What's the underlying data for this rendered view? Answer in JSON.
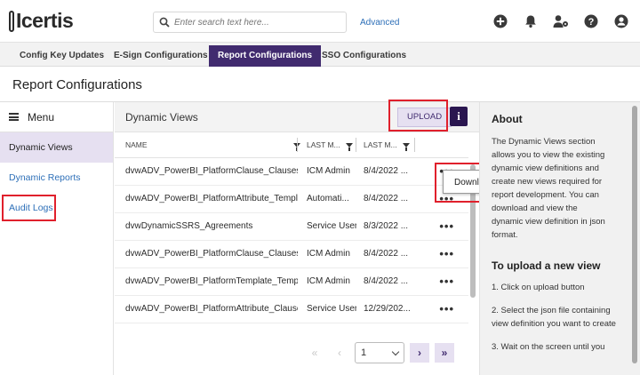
{
  "app": {
    "logo": "Icertis"
  },
  "search": {
    "placeholder": "Enter search text here...",
    "advanced_label": "Advanced"
  },
  "top_icons": [
    "add-icon",
    "bell-icon",
    "user-settings-icon",
    "help-icon",
    "account-icon"
  ],
  "tabs": [
    {
      "label": "Config Key Updates"
    },
    {
      "label": "E-Sign Configurations"
    },
    {
      "label": "Report Configurations",
      "active": true
    },
    {
      "label": "SSO Configurations"
    }
  ],
  "page": {
    "title": "Report Configurations"
  },
  "sidebar": {
    "menu_label": "Menu",
    "items": [
      {
        "label": "Dynamic Views",
        "active": true
      },
      {
        "label": "Dynamic Reports"
      },
      {
        "label": "Audit Logs"
      }
    ]
  },
  "panel": {
    "title": "Dynamic Views",
    "upload_label": "UPLOAD",
    "info_label": "i",
    "columns": [
      "NAME",
      "LAST M...",
      "LAST M..."
    ],
    "rows": [
      {
        "name": "dvwADV_PowerBI_PlatformClause_Clauses",
        "modified_by": "ICM Admin",
        "modified_on": "8/4/2022 ..."
      },
      {
        "name": "dvwADV_PowerBI_PlatformAttribute_Templa...",
        "modified_by": "Automati...",
        "modified_on": "8/4/2022 ..."
      },
      {
        "name": "dvwDynamicSSRS_Agreements",
        "modified_by": "Service User",
        "modified_on": "8/3/2022 ..."
      },
      {
        "name": "dvwADV_PowerBI_PlatformClause_ClausesP...",
        "modified_by": "ICM Admin",
        "modified_on": "8/4/2022 ..."
      },
      {
        "name": "dvwADV_PowerBI_PlatformTemplate_Templ...",
        "modified_by": "ICM Admin",
        "modified_on": "8/4/2022 ..."
      },
      {
        "name": "dvwADV_PowerBI_PlatformAttribute_Clauses",
        "modified_by": "Service User",
        "modified_on": "12/29/202..."
      }
    ],
    "row_action_label": "•••",
    "popup_label": "Download",
    "pagination": {
      "first": "«",
      "prev": "‹",
      "page": "1",
      "next": "›",
      "last": "»"
    }
  },
  "about": {
    "title": "About",
    "text": "The Dynamic Views section allows you to view the existing dynamic view definitions and create new views required for report development. You can download and view the dynamic view definition in json format.",
    "upload_title": "To upload a new view",
    "steps": [
      "1. Click on upload button",
      "2. Select the json file containing view definition you want to create",
      "3. Wait on the screen until you"
    ]
  },
  "colors": {
    "brand": "#412b6f",
    "accent_light": "#e6e0f1",
    "link": "#2d6fb8",
    "highlight": "#e0202c"
  }
}
